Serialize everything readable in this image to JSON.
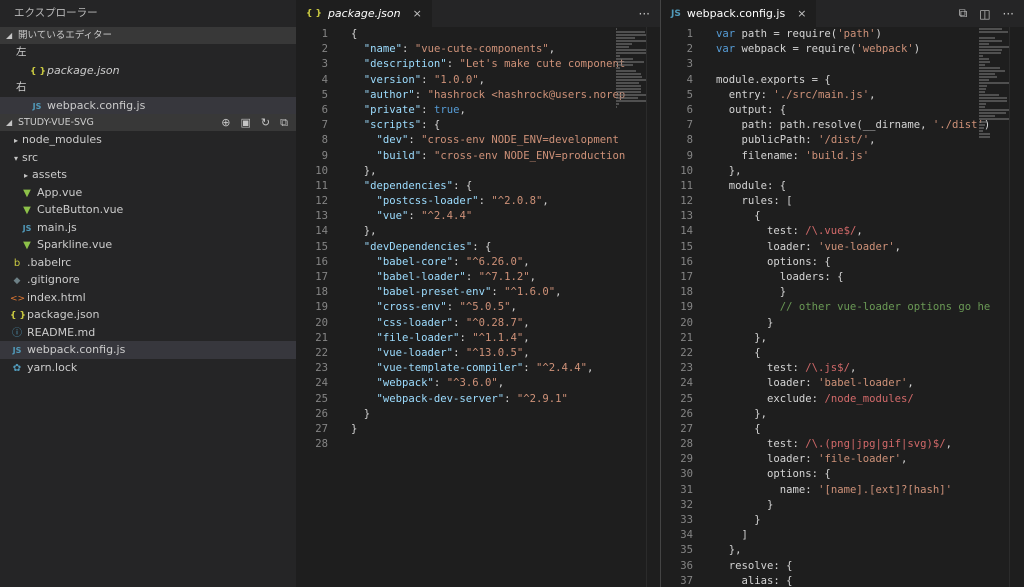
{
  "explorer": {
    "title": "エクスプローラー",
    "open_editors": {
      "title": "開いているエディター",
      "groups": [
        {
          "label": "左",
          "files": [
            {
              "icon": "{ }",
              "type": "json",
              "name": "package.json",
              "italic": true
            }
          ]
        },
        {
          "label": "右",
          "files": [
            {
              "icon": "JS",
              "type": "js",
              "name": "webpack.config.js",
              "italic": false
            }
          ]
        }
      ]
    },
    "project": {
      "title": "STUDY-VUE-SVG",
      "tree": [
        {
          "indent": 1,
          "arrow": "▸",
          "icon": "",
          "type": "",
          "name": "node_modules"
        },
        {
          "indent": 1,
          "arrow": "▾",
          "icon": "",
          "type": "",
          "name": "src"
        },
        {
          "indent": 2,
          "arrow": "▸",
          "icon": "",
          "type": "",
          "name": "assets"
        },
        {
          "indent": 2,
          "arrow": "",
          "icon": "▼",
          "type": "vue",
          "name": "App.vue"
        },
        {
          "indent": 2,
          "arrow": "",
          "icon": "▼",
          "type": "vue",
          "name": "CuteButton.vue"
        },
        {
          "indent": 2,
          "arrow": "",
          "icon": "JS",
          "type": "js",
          "name": "main.js"
        },
        {
          "indent": 2,
          "arrow": "",
          "icon": "▼",
          "type": "vue",
          "name": "Sparkline.vue"
        },
        {
          "indent": 1,
          "arrow": "",
          "icon": "b",
          "type": "babel",
          "name": ".babelrc"
        },
        {
          "indent": 1,
          "arrow": "",
          "icon": "◆",
          "type": "git",
          "name": ".gitignore"
        },
        {
          "indent": 1,
          "arrow": "",
          "icon": "<>",
          "type": "html",
          "name": "index.html"
        },
        {
          "indent": 1,
          "arrow": "",
          "icon": "{ }",
          "type": "json",
          "name": "package.json"
        },
        {
          "indent": 1,
          "arrow": "",
          "icon": "ⓘ",
          "type": "info",
          "name": "README.md"
        },
        {
          "indent": 1,
          "arrow": "",
          "icon": "JS",
          "type": "js",
          "name": "webpack.config.js",
          "selected": true
        },
        {
          "indent": 1,
          "arrow": "",
          "icon": "✿",
          "type": "yarn",
          "name": "yarn.lock"
        }
      ]
    }
  },
  "editor_left": {
    "tab": {
      "icon": "{ }",
      "name": "package.json",
      "close": "×"
    },
    "more": "···",
    "lines": [
      [
        [
          "p",
          "{"
        ]
      ],
      [
        [
          "p",
          "  "
        ],
        [
          "k",
          "\"name\""
        ],
        [
          "p",
          ": "
        ],
        [
          "s",
          "\"vue-cute-components\""
        ],
        [
          "p",
          ","
        ]
      ],
      [
        [
          "p",
          "  "
        ],
        [
          "k",
          "\"description\""
        ],
        [
          "p",
          ": "
        ],
        [
          "s",
          "\"Let's make cute component"
        ]
      ],
      [
        [
          "p",
          "  "
        ],
        [
          "k",
          "\"version\""
        ],
        [
          "p",
          ": "
        ],
        [
          "s",
          "\"1.0.0\""
        ],
        [
          "p",
          ","
        ]
      ],
      [
        [
          "p",
          "  "
        ],
        [
          "k",
          "\"author\""
        ],
        [
          "p",
          ": "
        ],
        [
          "s",
          "\"hashrock <hashrock@users.norep"
        ]
      ],
      [
        [
          "p",
          "  "
        ],
        [
          "k",
          "\"private\""
        ],
        [
          "p",
          ": "
        ],
        [
          "b",
          "true"
        ],
        [
          "p",
          ","
        ]
      ],
      [
        [
          "p",
          "  "
        ],
        [
          "k",
          "\"scripts\""
        ],
        [
          "p",
          ": {"
        ]
      ],
      [
        [
          "p",
          "    "
        ],
        [
          "k",
          "\"dev\""
        ],
        [
          "p",
          ": "
        ],
        [
          "s",
          "\"cross-env NODE_ENV=development"
        ]
      ],
      [
        [
          "p",
          "    "
        ],
        [
          "k",
          "\"build\""
        ],
        [
          "p",
          ": "
        ],
        [
          "s",
          "\"cross-env NODE_ENV=production"
        ]
      ],
      [
        [
          "p",
          "  },"
        ]
      ],
      [
        [
          "p",
          "  "
        ],
        [
          "k",
          "\"dependencies\""
        ],
        [
          "p",
          ": {"
        ]
      ],
      [
        [
          "p",
          "    "
        ],
        [
          "k",
          "\"postcss-loader\""
        ],
        [
          "p",
          ": "
        ],
        [
          "s",
          "\"^2.0.8\""
        ],
        [
          "p",
          ","
        ]
      ],
      [
        [
          "p",
          "    "
        ],
        [
          "k",
          "\"vue\""
        ],
        [
          "p",
          ": "
        ],
        [
          "s",
          "\"^2.4.4\""
        ]
      ],
      [
        [
          "p",
          "  },"
        ]
      ],
      [
        [
          "p",
          "  "
        ],
        [
          "k",
          "\"devDependencies\""
        ],
        [
          "p",
          ": {"
        ]
      ],
      [
        [
          "p",
          "    "
        ],
        [
          "k",
          "\"babel-core\""
        ],
        [
          "p",
          ": "
        ],
        [
          "s",
          "\"^6.26.0\""
        ],
        [
          "p",
          ","
        ]
      ],
      [
        [
          "p",
          "    "
        ],
        [
          "k",
          "\"babel-loader\""
        ],
        [
          "p",
          ": "
        ],
        [
          "s",
          "\"^7.1.2\""
        ],
        [
          "p",
          ","
        ]
      ],
      [
        [
          "p",
          "    "
        ],
        [
          "k",
          "\"babel-preset-env\""
        ],
        [
          "p",
          ": "
        ],
        [
          "s",
          "\"^1.6.0\""
        ],
        [
          "p",
          ","
        ]
      ],
      [
        [
          "p",
          "    "
        ],
        [
          "k",
          "\"cross-env\""
        ],
        [
          "p",
          ": "
        ],
        [
          "s",
          "\"^5.0.5\""
        ],
        [
          "p",
          ","
        ]
      ],
      [
        [
          "p",
          "    "
        ],
        [
          "k",
          "\"css-loader\""
        ],
        [
          "p",
          ": "
        ],
        [
          "s",
          "\"^0.28.7\""
        ],
        [
          "p",
          ","
        ]
      ],
      [
        [
          "p",
          "    "
        ],
        [
          "k",
          "\"file-loader\""
        ],
        [
          "p",
          ": "
        ],
        [
          "s",
          "\"^1.1.4\""
        ],
        [
          "p",
          ","
        ]
      ],
      [
        [
          "p",
          "    "
        ],
        [
          "k",
          "\"vue-loader\""
        ],
        [
          "p",
          ": "
        ],
        [
          "s",
          "\"^13.0.5\""
        ],
        [
          "p",
          ","
        ]
      ],
      [
        [
          "p",
          "    "
        ],
        [
          "k",
          "\"vue-template-compiler\""
        ],
        [
          "p",
          ": "
        ],
        [
          "s",
          "\"^2.4.4\""
        ],
        [
          "p",
          ","
        ]
      ],
      [
        [
          "p",
          "    "
        ],
        [
          "k",
          "\"webpack\""
        ],
        [
          "p",
          ": "
        ],
        [
          "s",
          "\"^3.6.0\""
        ],
        [
          "p",
          ","
        ]
      ],
      [
        [
          "p",
          "    "
        ],
        [
          "k",
          "\"webpack-dev-server\""
        ],
        [
          "p",
          ": "
        ],
        [
          "s",
          "\"^2.9.1\""
        ]
      ],
      [
        [
          "p",
          "  }"
        ]
      ],
      [
        [
          "p",
          "}"
        ]
      ],
      [
        [
          "p",
          ""
        ]
      ]
    ]
  },
  "editor_right": {
    "tab": {
      "icon": "JS",
      "name": "webpack.config.js",
      "close": "×"
    },
    "actions": [
      "⧉",
      "◫",
      "···"
    ],
    "lines": [
      [
        [
          "b",
          "var"
        ],
        [
          "p",
          " path = require("
        ],
        [
          "s",
          "'path'"
        ],
        [
          "p",
          ")"
        ]
      ],
      [
        [
          "b",
          "var"
        ],
        [
          "p",
          " webpack = require("
        ],
        [
          "s",
          "'webpack'"
        ],
        [
          "p",
          ")"
        ]
      ],
      [
        [
          "p",
          ""
        ]
      ],
      [
        [
          "p",
          "module.exports = {"
        ]
      ],
      [
        [
          "p",
          "  entry: "
        ],
        [
          "s",
          "'./src/main.js'"
        ],
        [
          "p",
          ","
        ]
      ],
      [
        [
          "p",
          "  output: {"
        ]
      ],
      [
        [
          "p",
          "    path: path.resolve(__dirname, "
        ],
        [
          "s",
          "'./dist'"
        ],
        [
          "p",
          ")"
        ]
      ],
      [
        [
          "p",
          "    publicPath: "
        ],
        [
          "s",
          "'/dist/'"
        ],
        [
          "p",
          ","
        ]
      ],
      [
        [
          "p",
          "    filename: "
        ],
        [
          "s",
          "'build.js'"
        ]
      ],
      [
        [
          "p",
          "  },"
        ]
      ],
      [
        [
          "p",
          "  module: {"
        ]
      ],
      [
        [
          "p",
          "    rules: ["
        ]
      ],
      [
        [
          "p",
          "      {"
        ]
      ],
      [
        [
          "p",
          "        test: "
        ],
        [
          "r",
          "/\\.vue$/"
        ],
        [
          "p",
          ","
        ]
      ],
      [
        [
          "p",
          "        loader: "
        ],
        [
          "s",
          "'vue-loader'"
        ],
        [
          "p",
          ","
        ]
      ],
      [
        [
          "p",
          "        options: {"
        ]
      ],
      [
        [
          "p",
          "          loaders: {"
        ]
      ],
      [
        [
          "p",
          "          }"
        ]
      ],
      [
        [
          "c",
          "          // other vue-loader options go he"
        ]
      ],
      [
        [
          "p",
          "        }"
        ]
      ],
      [
        [
          "p",
          "      },"
        ]
      ],
      [
        [
          "p",
          "      {"
        ]
      ],
      [
        [
          "p",
          "        test: "
        ],
        [
          "r",
          "/\\.js$/"
        ],
        [
          "p",
          ","
        ]
      ],
      [
        [
          "p",
          "        loader: "
        ],
        [
          "s",
          "'babel-loader'"
        ],
        [
          "p",
          ","
        ]
      ],
      [
        [
          "p",
          "        exclude: "
        ],
        [
          "r",
          "/node_modules/"
        ]
      ],
      [
        [
          "p",
          "      },"
        ]
      ],
      [
        [
          "p",
          "      {"
        ]
      ],
      [
        [
          "p",
          "        test: "
        ],
        [
          "r",
          "/\\.(png|jpg|gif|svg)$/"
        ],
        [
          "p",
          ","
        ]
      ],
      [
        [
          "p",
          "        loader: "
        ],
        [
          "s",
          "'file-loader'"
        ],
        [
          "p",
          ","
        ]
      ],
      [
        [
          "p",
          "        options: {"
        ]
      ],
      [
        [
          "p",
          "          name: "
        ],
        [
          "s",
          "'[name].[ext]?[hash]'"
        ]
      ],
      [
        [
          "p",
          "        }"
        ]
      ],
      [
        [
          "p",
          "      }"
        ]
      ],
      [
        [
          "p",
          "    ]"
        ]
      ],
      [
        [
          "p",
          "  },"
        ]
      ],
      [
        [
          "p",
          "  resolve: {"
        ]
      ],
      [
        [
          "p",
          "    alias: {"
        ]
      ]
    ]
  }
}
